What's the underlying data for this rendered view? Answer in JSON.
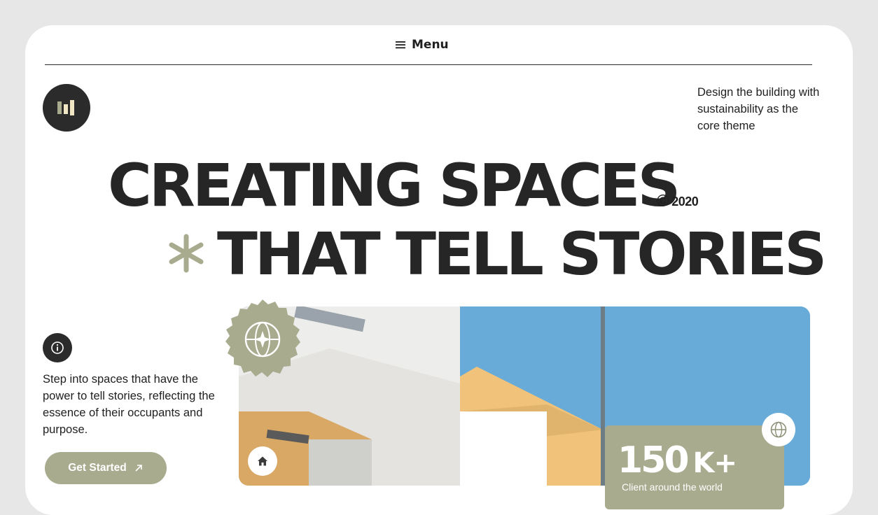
{
  "nav": {
    "menu_label": "Menu",
    "menu_icon": "hamburger-icon"
  },
  "brand": {
    "logo_icon": "bars-logo-icon"
  },
  "tagline": "Design the building with sustainability as the core theme",
  "headline": {
    "line1": "CREATING SPACES",
    "line2": "THAT TELL STORIES",
    "year": "2020",
    "year_symbol": "©",
    "decoration_icon": "asterisk-icon"
  },
  "intro": {
    "info_icon": "info-icon",
    "description": "Step into spaces that have the power to tell stories, reflecting the essence of their occupants and purpose.",
    "cta_label": "Get Started",
    "cta_icon": "arrow-up-right-icon"
  },
  "hero_image": {
    "seal_icon": "globe-star-icon",
    "home_icon": "home-icon",
    "globe_icon": "globe-icon"
  },
  "stat": {
    "value": "150",
    "suffix": "K+",
    "caption": "Client around the world"
  },
  "colors": {
    "accent": "#a8ab8e",
    "dark": "#2b2b2b",
    "sky": "#66a8d4",
    "background": "#e7e7e7"
  }
}
